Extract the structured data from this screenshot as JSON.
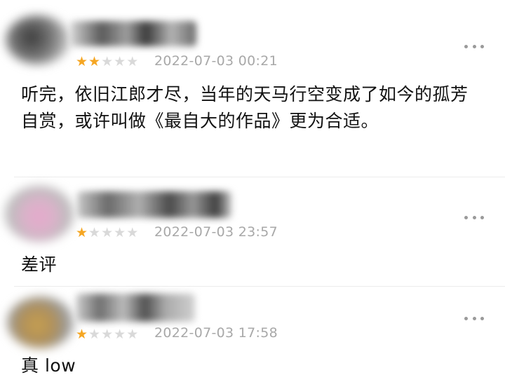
{
  "comments": [
    {
      "rating": 2,
      "max_rating": 5,
      "date": "2022-07-03 00:21",
      "text": "听完，依旧江郎才尽，当年的天马行空变成了如今的孤芳自赏，或许叫做《最自大的作品》更为合适。",
      "more_icon": "ellipsis-icon"
    },
    {
      "rating": 1,
      "max_rating": 5,
      "date": "2022-07-03 23:57",
      "text": "差评",
      "more_icon": "ellipsis-icon"
    },
    {
      "rating": 1,
      "max_rating": 5,
      "date": "2022-07-03 17:58",
      "text": "真 low",
      "more_icon": "ellipsis-icon"
    }
  ],
  "colors": {
    "star_filled": "#f5a623",
    "star_empty": "#d9d9d9",
    "date_text": "#a8a8a8",
    "body_text": "#111111"
  }
}
